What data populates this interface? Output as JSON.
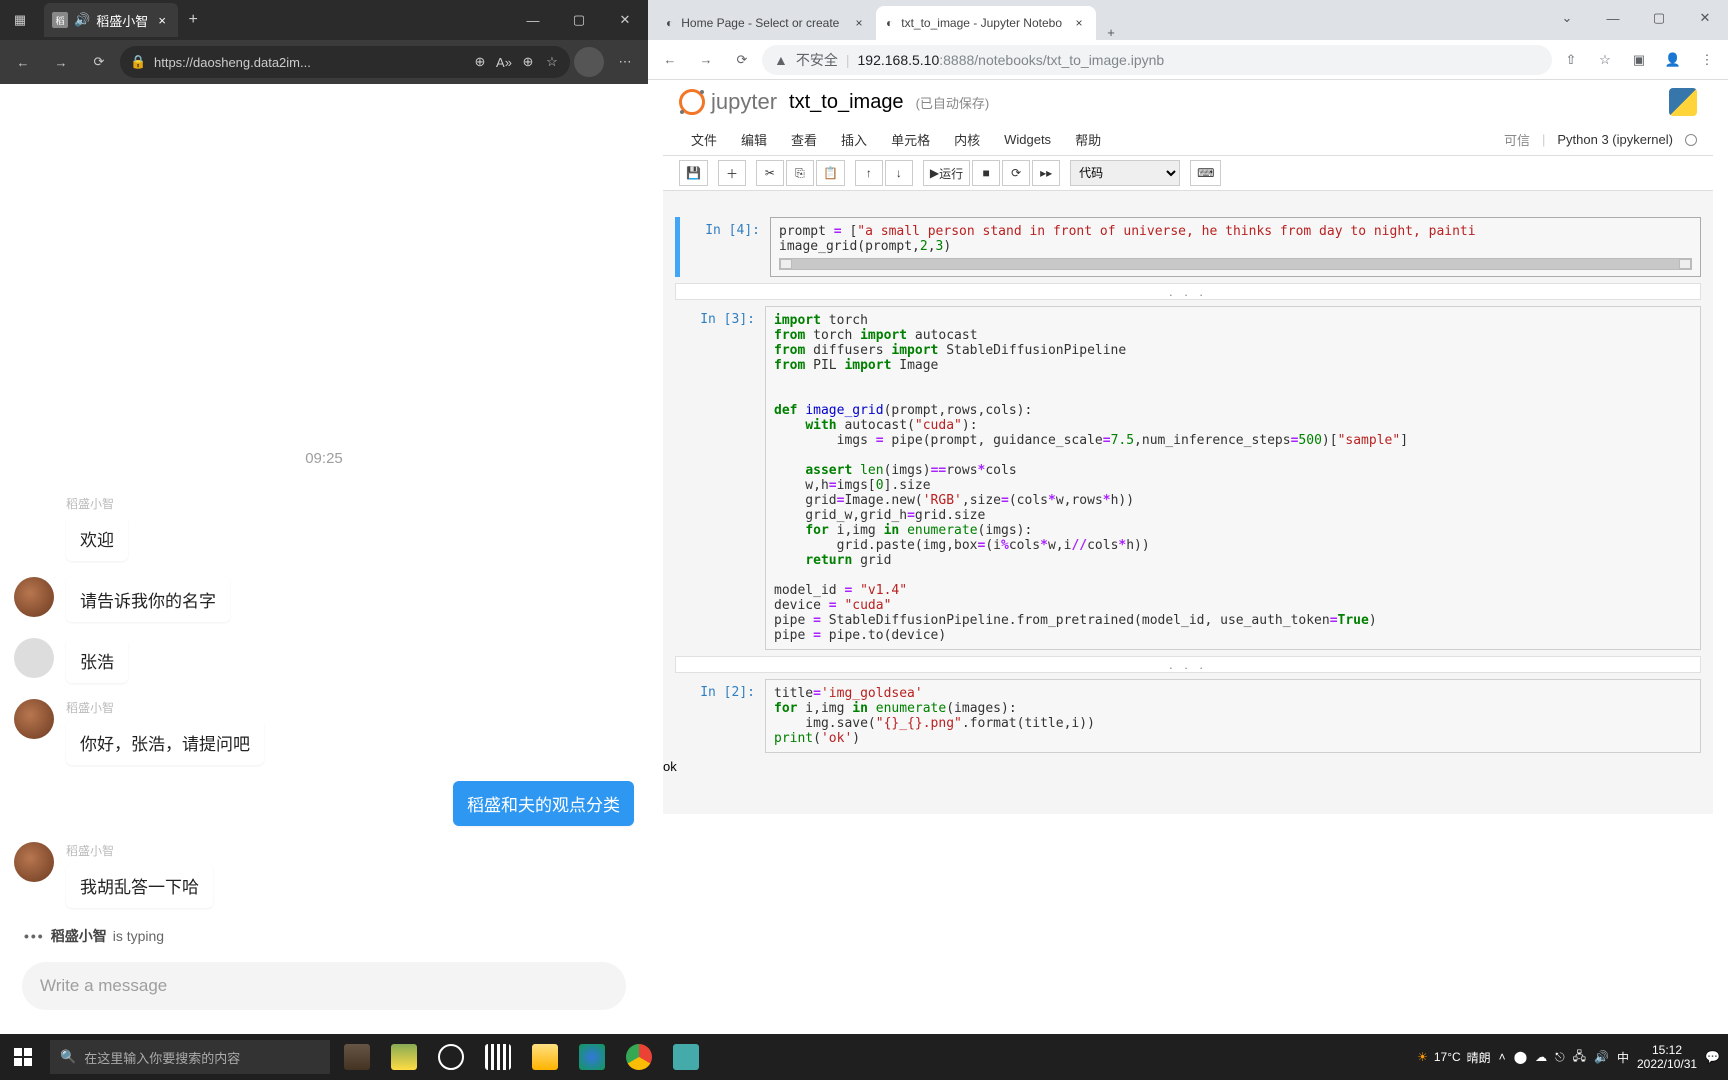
{
  "left_browser": {
    "tab_title": "稻盛小智",
    "url": "https://daosheng.data2im..."
  },
  "chat": {
    "time": "09:25",
    "bot_name": "稻盛小智",
    "user_name": "张浩",
    "messages": [
      {
        "from": "bot",
        "text": "欢迎",
        "show_avatar": false
      },
      {
        "from": "bot",
        "text": "请告诉我你的名字",
        "show_avatar": true
      },
      {
        "from": "user_zh",
        "text": "张浩",
        "show_avatar": true
      },
      {
        "from": "bot",
        "text": "你好，张浩，请提问吧",
        "show_avatar": true
      },
      {
        "from": "user_right",
        "text": "稻盛和夫的观点分类",
        "show_avatar": false
      },
      {
        "from": "bot",
        "text": "我胡乱答一下哈",
        "show_avatar": true
      }
    ],
    "typing_suffix": " is typing",
    "input_placeholder": "Write a message"
  },
  "right_browser": {
    "tabs": [
      {
        "title": "Home Page - Select or create",
        "active": false
      },
      {
        "title": "txt_to_image - Jupyter Notebo",
        "active": true
      }
    ],
    "insecure_label": "不安全",
    "url_host": "192.168.5.10",
    "url_path": ":8888/notebooks/txt_to_image.ipynb"
  },
  "jupyter": {
    "logo_text": "jupyter",
    "notebook_name": "txt_to_image",
    "saved_text": "(已自动保存)",
    "menus": [
      "文件",
      "编辑",
      "查看",
      "插入",
      "单元格",
      "内核",
      "Widgets",
      "帮助"
    ],
    "trusted": "可信",
    "kernel_name": "Python 3 (ipykernel)",
    "run_label": "运行",
    "cell_type": "代码",
    "cells": [
      {
        "prompt": "In  [4]:",
        "selected": true,
        "code_html": "prompt <span class='op'>=</span> [<span class='str'>\"a small person stand in front of universe, he thinks from day to night, painti</span>\nimage_grid(prompt,<span class='num'>2</span>,<span class='num'>3</span>)",
        "scroll": true,
        "collapsed_after": true
      },
      {
        "prompt": "In  [3]:",
        "selected": false,
        "code_html": "<span class='kw'>import</span> torch\n<span class='kw'>from</span> torch <span class='kw'>import</span> autocast\n<span class='kw'>from</span> diffusers <span class='kw'>import</span> StableDiffusionPipeline\n<span class='kw'>from</span> PIL <span class='kw'>import</span> Image\n\n\n<span class='kw'>def</span> <span class='fn'>image_grid</span>(prompt,rows,cols):\n    <span class='kw'>with</span> autocast(<span class='str'>\"cuda\"</span>):\n        imgs <span class='op'>=</span> pipe(prompt, guidance_scale<span class='op'>=</span><span class='num'>7.5</span>,num_inference_steps<span class='op'>=</span><span class='num'>500</span>)[<span class='str'>\"sample\"</span>]\n\n    <span class='kw'>assert</span> <span class='bi'>len</span>(imgs)<span class='op'>==</span>rows<span class='op'>*</span>cols\n    w,h<span class='op'>=</span>imgs[<span class='num'>0</span>].size\n    grid<span class='op'>=</span>Image.new(<span class='str'>'RGB'</span>,size<span class='op'>=</span>(cols<span class='op'>*</span>w,rows<span class='op'>*</span>h))\n    grid_w,grid_h<span class='op'>=</span>grid.size\n    <span class='kw'>for</span> i,img <span class='kw'>in</span> <span class='bi'>enumerate</span>(imgs):\n        grid.paste(img,box<span class='op'>=</span>(i<span class='op'>%</span>cols<span class='op'>*</span>w,i<span class='op'>//</span>cols<span class='op'>*</span>h))\n    <span class='kw'>return</span> grid\n\nmodel_id <span class='op'>=</span> <span class='str'>\"v1.4\"</span>\ndevice <span class='op'>=</span> <span class='str'>\"cuda\"</span>\npipe <span class='op'>=</span> StableDiffusionPipeline.from_pretrained(model_id, use_auth_token<span class='op'>=</span><span class='kw'>True</span>)\npipe <span class='op'>=</span> pipe.to(device)",
        "collapsed_after": true
      },
      {
        "prompt": "In  [2]:",
        "selected": false,
        "code_html": "title<span class='op'>=</span><span class='str'>'img_goldsea'</span>\n<span class='kw'>for</span> i,img <span class='kw'>in</span> <span class='bi'>enumerate</span>(images):\n    img.save(<span class='str'>\"{}_{}.png\"</span>.format(title,i))\n<span class='bi'>print</span>(<span class='str'>'ok'</span>)",
        "output": "ok"
      }
    ]
  },
  "taskbar": {
    "search_placeholder": "在这里输入你要搜索的内容",
    "weather_temp": "17°C",
    "weather_cond": "晴朗",
    "ime": "中",
    "time": "15:12",
    "date": "2022/10/31"
  }
}
